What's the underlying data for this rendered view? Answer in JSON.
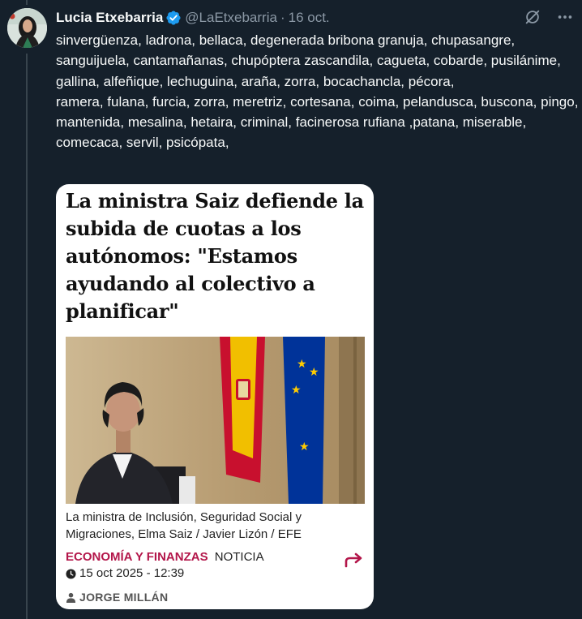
{
  "tweet": {
    "author_name": "Lucia Etxebarria",
    "handle": "@LaEtxebarria",
    "separator": "·",
    "date": "16 oct.",
    "text": "sinvergüenza, ladrona, bellaca, degenerada bribona granuja, chupasangre, sanguijuela, cantamañanas, chupóptera zascandila, cagueta, cobarde, pusilánime, gallina, alfeñique, lechuguina, araña, zorra, bocachancla, pécora,\nramera, fulana, furcia, zorra, meretriz, cortesana, coima, pelandusca, buscona, pingo, mantenida, mesalina, hetaira, criminal, facinerosa rufiana ,patana, miserable, comecaca, servil, psicópata,",
    "icons": {
      "verified": "verified-badge-icon",
      "grok": "grok-icon",
      "more": "more-icon"
    }
  },
  "card": {
    "headline": "La ministra Saiz defiende la subida de cuotas a los autónomos: \"Estamos ayudando al colectivo a planificar\"",
    "caption": "La ministra de Inclusión, Seguridad Social y Migraciones, Elma Saiz /  Javier Lizón / EFE",
    "section": "ECONOMÍA Y FINANZAS",
    "type": "NOTICIA",
    "date": "15 oct 2025 - 12:39",
    "author": "JORGE MILLÁN",
    "colors": {
      "accent": "#b3164a",
      "background": "#ffffff"
    }
  },
  "theme": {
    "background": "#15202b",
    "text": "#f7f9f9",
    "muted": "#8b98a5",
    "verified": "#1d9bf0"
  }
}
